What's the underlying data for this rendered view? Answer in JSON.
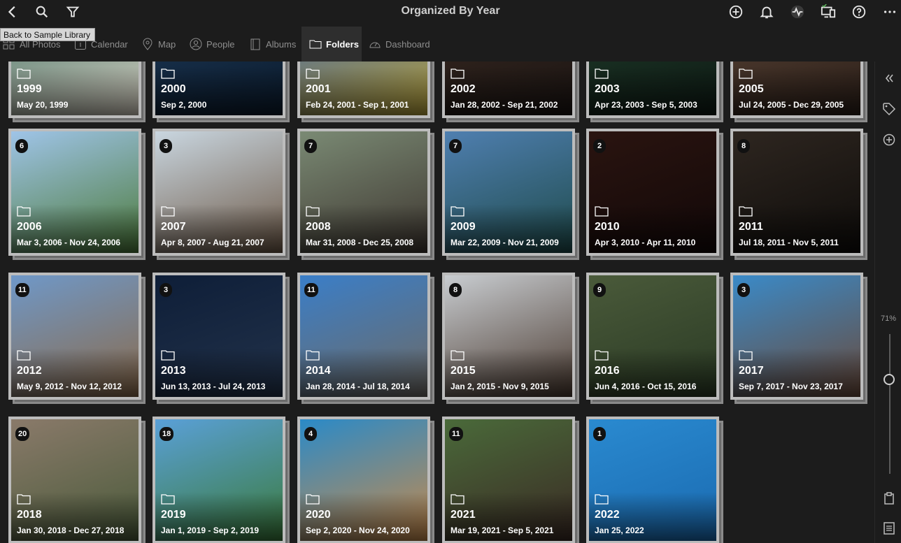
{
  "header": {
    "title": "Organized By Year",
    "tooltip": "Back to Sample Library"
  },
  "tabs": [
    {
      "label": "All Photos",
      "icon": "grid-icon"
    },
    {
      "label": "Calendar",
      "icon": "calendar-icon"
    },
    {
      "label": "Map",
      "icon": "map-pin-icon"
    },
    {
      "label": "People",
      "icon": "person-icon"
    },
    {
      "label": "Albums",
      "icon": "album-icon"
    },
    {
      "label": "Folders",
      "icon": "folder-icon",
      "active": true
    },
    {
      "label": "Dashboard",
      "icon": "gauge-icon"
    }
  ],
  "zoom": {
    "label": "71%",
    "value": 0.71
  },
  "folders": [
    {
      "year": "1999",
      "dates": "May 20, 1999",
      "count": "",
      "color1": "#3b6a5e",
      "color2": "#d9d2c4"
    },
    {
      "year": "2000",
      "dates": "Sep 2, 2000",
      "count": "",
      "color1": "#1d3a5a",
      "color2": "#0b1a2b"
    },
    {
      "year": "2001",
      "dates": "Feb 24, 2001 - Sep 1, 2001",
      "count": "",
      "color1": "#3a5fa8",
      "color2": "#b8a23a"
    },
    {
      "year": "2002",
      "dates": "Jan 28, 2002 - Sep 21, 2002",
      "count": "",
      "color1": "#3a2a22",
      "color2": "#1a1412"
    },
    {
      "year": "2003",
      "dates": "Apr 23, 2003 - Sep 5, 2003",
      "count": "",
      "color1": "#1f3b2a",
      "color2": "#0e1a14"
    },
    {
      "year": "2005",
      "dates": "Jul 24, 2005 - Dec 29, 2005",
      "count": "",
      "color1": "#5a4436",
      "color2": "#2a1e18"
    },
    {
      "year": "2006",
      "dates": "Mar 3, 2006 - Nov 24, 2006",
      "count": "6",
      "color1": "#9fc4e8",
      "color2": "#4c7a3a"
    },
    {
      "year": "2007",
      "dates": "Apr 8, 2007 - Aug 21, 2007",
      "count": "3",
      "color1": "#c9d6e0",
      "color2": "#6e5a48"
    },
    {
      "year": "2008",
      "dates": "Mar 31, 2008 - Dec 25, 2008",
      "count": "7",
      "color1": "#7a8a74",
      "color2": "#3e3630"
    },
    {
      "year": "2009",
      "dates": "Mar 22, 2009 - Nov 21, 2009",
      "count": "7",
      "color1": "#4f7fb0",
      "color2": "#1e4a4a"
    },
    {
      "year": "2010",
      "dates": "Apr 3, 2010 - Apr 11, 2010",
      "count": "2",
      "color1": "#2a1410",
      "color2": "#120808"
    },
    {
      "year": "2011",
      "dates": "Jul 18, 2011 - Nov 5, 2011",
      "count": "8",
      "color1": "#2e2620",
      "color2": "#0e0c0a"
    },
    {
      "year": "2012",
      "dates": "May 9, 2012 - Nov 12, 2012",
      "count": "11",
      "color1": "#6f98c8",
      "color2": "#8a6a4a"
    },
    {
      "year": "2013",
      "dates": "Jun 13, 2013 - Jul 24, 2013",
      "count": "3",
      "color1": "#0e1e38",
      "color2": "#22324a"
    },
    {
      "year": "2014",
      "dates": "Jan 28, 2014 - Jul 18, 2014",
      "count": "11",
      "color1": "#3a7ec8",
      "color2": "#6e6a64"
    },
    {
      "year": "2015",
      "dates": "Jan 2, 2015 - Nov 9, 2015",
      "count": "8",
      "color1": "#c8ccd0",
      "color2": "#4a3a30"
    },
    {
      "year": "2016",
      "dates": "Jun 4, 2016 - Oct 15, 2016",
      "count": "9",
      "color1": "#4a5a3a",
      "color2": "#2a3a24"
    },
    {
      "year": "2017",
      "dates": "Sep 7, 2017 - Nov 23, 2017",
      "count": "3",
      "color1": "#3a8ac8",
      "color2": "#6a4a3a"
    },
    {
      "year": "2018",
      "dates": "Jan 30, 2018 - Dec 27, 2018",
      "count": "20",
      "color1": "#8a7a6a",
      "color2": "#4a5a3a"
    },
    {
      "year": "2019",
      "dates": "Jan 1, 2019 - Sep 2, 2019",
      "count": "18",
      "color1": "#5aa0d8",
      "color2": "#3a7a3a"
    },
    {
      "year": "2020",
      "dates": "Sep 2, 2020 - Nov 24, 2020",
      "count": "4",
      "color1": "#2a8ac8",
      "color2": "#c88a4a"
    },
    {
      "year": "2021",
      "dates": "Mar 19, 2021 - Sep 5, 2021",
      "count": "11",
      "color1": "#4a6a3a",
      "color2": "#3a2a24"
    },
    {
      "year": "2022",
      "dates": "Jan 25, 2022",
      "count": "1",
      "color1": "#2a8ad0",
      "color2": "#1a6ab0"
    }
  ]
}
